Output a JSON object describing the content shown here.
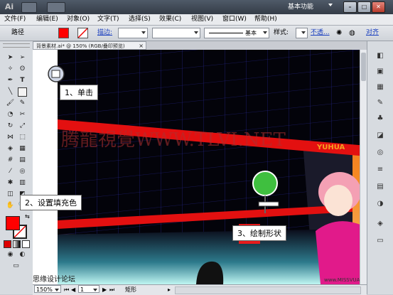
{
  "app": {
    "logo": "Ai",
    "workspace_label": "基本功能",
    "window_buttons": [
      "–",
      "□",
      "✕"
    ]
  },
  "menu": {
    "items": [
      "文件(F)",
      "编辑(E)",
      "对象(O)",
      "文字(T)",
      "选择(S)",
      "效果(C)",
      "视图(V)",
      "窗口(W)",
      "帮助(H)"
    ]
  },
  "control_bar": {
    "selection_label": "路径",
    "stroke_label": "描边:",
    "stroke_style_label": "基本",
    "style_label": "样式:",
    "opacity_label": "不透...",
    "align_label": "对齐",
    "fill_color": "#ff0000",
    "accent_color": "#ff0000"
  },
  "document": {
    "tab_title": "背景素材.ai* @ 150% (RGB/叠印预览)",
    "close_icon": "×"
  },
  "status_bar": {
    "zoom": "150%",
    "page": "1",
    "tool_name": "矩形"
  },
  "annotations": {
    "step1": "1、单击",
    "step2": "2、设置填充色",
    "step3": "3、绘制形状"
  },
  "artwork": {
    "watermark": "腾龍視覺WWW.TLVI.NET",
    "store_name": "YUHUA",
    "footer_watermark_left": "思缘设计论坛",
    "footer_watermark_right": "www.MISSVUAN.com"
  }
}
